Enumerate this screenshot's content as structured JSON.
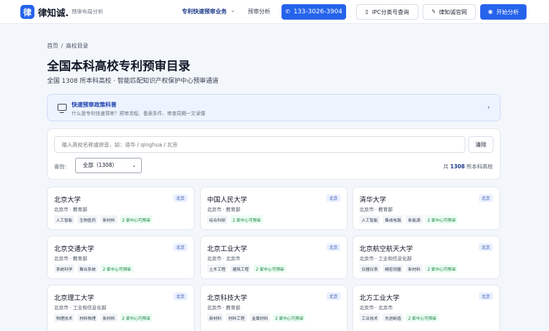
{
  "header": {
    "logo_char": "律",
    "brand": "律知诚.",
    "tagline": "预审布局分析",
    "nav_primary": "专利快速预审业务",
    "nav_secondary": "预审分析",
    "phone": "133-3026-3904",
    "ipc_button": "IPC分类号查询",
    "site_button": "律知诚官网",
    "start_button": "开始分析",
    "icons": {
      "phone": "phone-icon",
      "ipc": "document-icon",
      "site": "bolt-icon",
      "start": "check-circle-icon"
    }
  },
  "breadcrumb": {
    "home": "首页",
    "sep": "/",
    "current": "高校目录"
  },
  "page": {
    "title": "全国本科高校专利预审目录",
    "subtitle": "全国 1308 所本科高校 · 智能匹配知识产权保护中心预审通道"
  },
  "notice": {
    "title": "快速预审政策科普",
    "desc": "什么是专利快速预审？预审流程、备案条件、审查周期一文读懂"
  },
  "search": {
    "placeholder": "输入高校名称或拼音，如：清华 / qinghua / 北京",
    "clear_label": "清除",
    "province_label": "省份:",
    "province_value": "全部（1308）",
    "count_prefix": "共",
    "count_value": "1308",
    "count_suffix": "所本科高校"
  },
  "colors": {
    "accent": "#2563eb",
    "green_tag": "#15803d",
    "badge": "#3b5bb5"
  },
  "universities": [
    {
      "name": "北京大学",
      "badge": "北京",
      "meta": "北京市 · 教育部",
      "tags": [
        "人工智能",
        "生物医药",
        "新材料"
      ],
      "center": "2 家中心可预审"
    },
    {
      "name": "中国人民大学",
      "badge": "北京",
      "meta": "北京市 · 教育部",
      "tags": [
        "综合科研"
      ],
      "center": "2 家中心可预审"
    },
    {
      "name": "清华大学",
      "badge": "北京",
      "meta": "北京市 · 教育部",
      "tags": [
        "人工智能",
        "集成电路",
        "新能源"
      ],
      "center": "2 家中心可预审"
    },
    {
      "name": "北京交通大学",
      "badge": "北京",
      "meta": "北京市 · 教育部",
      "tags": [
        "系统科学",
        "聚合系统"
      ],
      "center": "2 家中心可预审"
    },
    {
      "name": "北京工业大学",
      "badge": "北京",
      "meta": "北京市 · 北京市",
      "tags": [
        "土木工程",
        "建筑工程"
      ],
      "center": "2 家中心可预审"
    },
    {
      "name": "北京航空航天大学",
      "badge": "北京",
      "meta": "北京市 · 工业和信息化部",
      "tags": [
        "仪器仪表",
        "精密测量",
        "新材料"
      ],
      "center": "2 家中心可预审"
    },
    {
      "name": "北京理工大学",
      "badge": "北京",
      "meta": "北京市 · 工业和信息化部",
      "tags": [
        "物理技术",
        "材料物理",
        "新材料"
      ],
      "center": "2 家中心可预审"
    },
    {
      "name": "北京科技大学",
      "badge": "北京",
      "meta": "北京市 · 教育部",
      "tags": [
        "新材料",
        "材料工程",
        "金属材料"
      ],
      "center": "2 家中心可预审"
    },
    {
      "name": "北方工业大学",
      "badge": "北京",
      "meta": "北京市 · 北京市",
      "tags": [
        "工业技术",
        "先进制造"
      ],
      "center": "2 家中心可预审"
    }
  ]
}
